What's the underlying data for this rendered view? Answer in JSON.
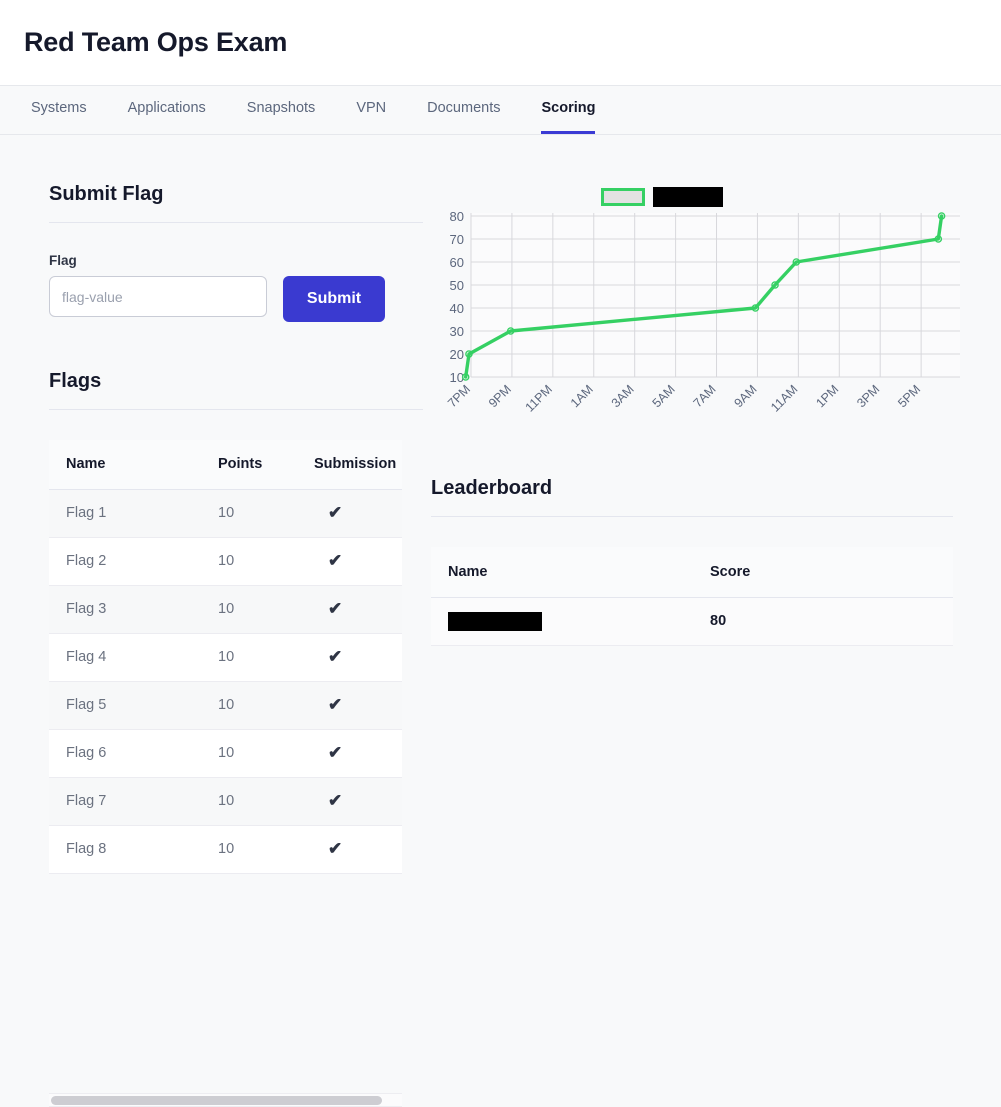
{
  "header": {
    "title": "Red Team Ops Exam"
  },
  "tabs": [
    {
      "label": "Systems",
      "active": false
    },
    {
      "label": "Applications",
      "active": false
    },
    {
      "label": "Snapshots",
      "active": false
    },
    {
      "label": "VPN",
      "active": false
    },
    {
      "label": "Documents",
      "active": false
    },
    {
      "label": "Scoring",
      "active": true
    }
  ],
  "submit_flag": {
    "heading": "Submit Flag",
    "field_label": "Flag",
    "input_value": "",
    "input_placeholder": "flag-value",
    "button_label": "Submit"
  },
  "flags": {
    "heading": "Flags",
    "columns": [
      "Name",
      "Points",
      "Submission"
    ],
    "rows": [
      {
        "name": "Flag 1",
        "points": "10",
        "submission": "✔"
      },
      {
        "name": "Flag 2",
        "points": "10",
        "submission": "✔"
      },
      {
        "name": "Flag 3",
        "points": "10",
        "submission": "✔"
      },
      {
        "name": "Flag 4",
        "points": "10",
        "submission": "✔"
      },
      {
        "name": "Flag 5",
        "points": "10",
        "submission": "✔"
      },
      {
        "name": "Flag 6",
        "points": "10",
        "submission": "✔"
      },
      {
        "name": "Flag 7",
        "points": "10",
        "submission": "✔"
      },
      {
        "name": "Flag 8",
        "points": "10",
        "submission": "✔"
      }
    ]
  },
  "leaderboard": {
    "heading": "Leaderboard",
    "columns": [
      "Name",
      "Score"
    ],
    "rows": [
      {
        "name": "",
        "name_redacted": true,
        "score": "80"
      }
    ]
  },
  "colors": {
    "accent": "#3a3ad0",
    "series_green": "#35d063",
    "page_bg": "#f8f9fa",
    "heading": "#15192b"
  },
  "chart_data": {
    "type": "line",
    "title": "",
    "xlabel": "",
    "ylabel": "",
    "ylim": [
      10,
      80
    ],
    "yticks": [
      10,
      20,
      30,
      40,
      50,
      60,
      70,
      80
    ],
    "xticks": [
      "7PM",
      "9PM",
      "11PM",
      "1AM",
      "3AM",
      "5AM",
      "7AM",
      "9AM",
      "11AM",
      "1PM",
      "3PM",
      "5PM"
    ],
    "grid": true,
    "legend_position": "top-center",
    "legend": [
      {
        "name": "",
        "redacted": true,
        "color": "#35d063"
      }
    ],
    "series": [
      {
        "name": "",
        "color": "#35d063",
        "x": [
          "6:50PM",
          "7:00PM",
          "9:00PM",
          "9:00AM",
          "10:00AM",
          "11:00AM",
          "5:40PM",
          "5:50PM"
        ],
        "values": [
          10,
          20,
          30,
          40,
          50,
          60,
          70,
          80
        ]
      }
    ]
  }
}
